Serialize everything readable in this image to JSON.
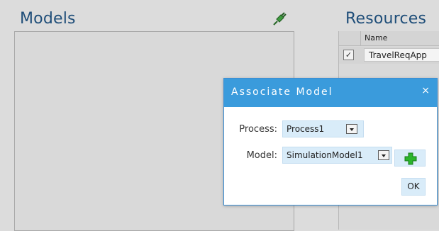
{
  "models": {
    "title": "Models",
    "connect_icon": "plug-icon"
  },
  "resources": {
    "title": "Resources",
    "columns": [
      "Name"
    ],
    "rows": [
      {
        "checked": true,
        "check_glyph": "✓",
        "name": "TravelReqApp"
      }
    ]
  },
  "dialog": {
    "title": "Associate Model",
    "close_glyph": "×",
    "process_label": "Process:",
    "process_value": "Process1",
    "model_label": "Model:",
    "model_value": "SimulationModel1",
    "add_icon": "plus-icon",
    "ok_label": "OK"
  },
  "colors": {
    "title_blue": "#1f4e79",
    "dialog_header": "#3a9bdc",
    "control_bg": "#d9ecf9",
    "plus_green": "#2bb52b"
  }
}
